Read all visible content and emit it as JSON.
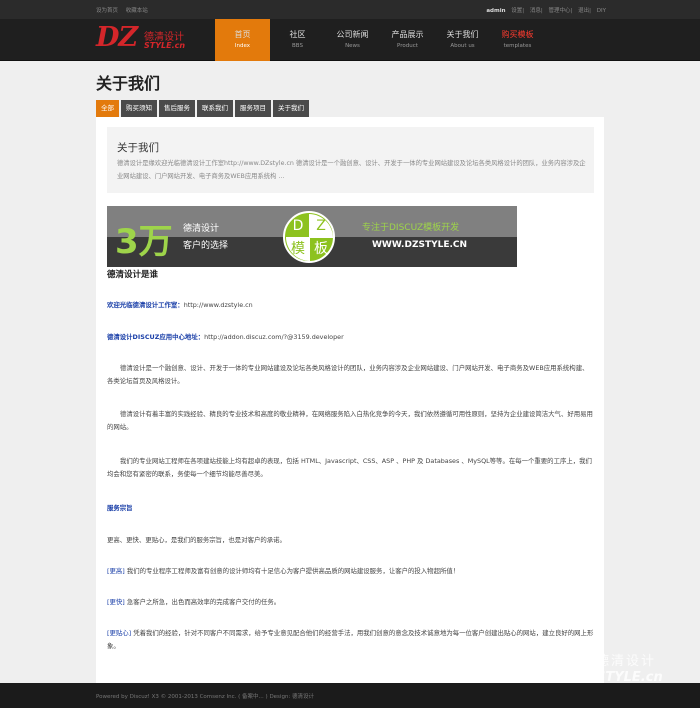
{
  "topbar": {
    "left": [
      "设为首页",
      "收藏本站"
    ],
    "user": "admin",
    "right": [
      "设置",
      "消息",
      "管理中心",
      "退出",
      "DIY"
    ]
  },
  "logo": {
    "dz": "DZ",
    "cn": "德清设计",
    "en": "STYLE.cn"
  },
  "nav": [
    {
      "title": "首页",
      "sub": "Index"
    },
    {
      "title": "社区",
      "sub": "BBS"
    },
    {
      "title": "公司新闻",
      "sub": "News"
    },
    {
      "title": "产品展示",
      "sub": "Product"
    },
    {
      "title": "关于我们",
      "sub": "About us"
    },
    {
      "title": "购买模板",
      "sub": "templates"
    }
  ],
  "page_title": "关于我们",
  "tabs": [
    "全部",
    "购买须知",
    "售后服务",
    "联系我们",
    "服务项目",
    "关于我们"
  ],
  "intro": {
    "title": "关于我们",
    "text": "德清设计是缘欢迎光临德清设计工作室http://www.DZstyle.cn 德清设计是一个融创意、设计、开发于一体的专业网站建设及论坛各类风格设计的团队，业务内容涉及企业网站建设、门户网站开发、电子商务及WEB应用系统构 ..."
  },
  "banner": {
    "num": "3万",
    "line1": "德清设计",
    "line2": "客户的选择",
    "quad": [
      "D",
      "Z",
      "模",
      "板"
    ],
    "slogan": "专注于DISCUZ模板开发",
    "url": "WWW.DZSTYLE.CN"
  },
  "body": {
    "heading": "德清设计是谁",
    "welcome_label": "欢迎光临德清设计工作室：",
    "welcome_url": "http://www.dzstyle.cn",
    "center_label": "德清设计DISCUZ应用中心地址：",
    "center_url": "http://addon.discuz.com/?@3159.developer",
    "p1": "德清设计是一个融创意、设计、开发于一体的专业网站建设及论坛各类风格设计的团队，业务内容涉及企业网站建设、门户网站开发、电子商务及WEB应用系统构建、各类论坛首页及风格设计。",
    "p2": "德清设计有着丰富的实践经验、精良的专业技术和高度的敬业精神，在网络服务陷入白热化竞争的今天，我们依然遵循可用性原则，坚持为企业建设简洁大气、好用易用的网站。",
    "p3": "我们的专业网站工程师在各项建站技能上均有超卓的表现，包括 HTML、Javascript、CSS、ASP 、PHP 及 Databases 、MySQL等等。在每一个重要的工序上，我们均会和您有紧密的联系，务使每一个细节均能尽善尽美。",
    "service_heading": "服务宗旨",
    "p4": "更高、更快、更贴心，是我们的服务宗旨，也是对客户的承诺。",
    "higher_tag": "[更高]",
    "higher_text": "我们的专业程序工程师及富有创意的设计师均有十足信心为客户提供高品质的网站建设服务，让客户的投入物超所值！",
    "faster_tag": "[更快]",
    "faster_text": "急客户之所急，出色而高效率的完成客户交付的任务。",
    "closer_tag": "[更贴心]",
    "closer_text": "凭着我们的经验，针对不同客户不同需求，给予专业意见配合他们的经营手法，用我们创意的意念及技术诚意地为每一位客户创建出贴心的网站，建立良好的网上形象。"
  },
  "footer": "Powered by Discuz! X3  © 2001-2013  Comsenz Inc. ( 备案中... )  Design: 德清设计",
  "watermark": {
    "dz": "DZ",
    "cn": "德清设计",
    "en": "STYLE.cn"
  }
}
